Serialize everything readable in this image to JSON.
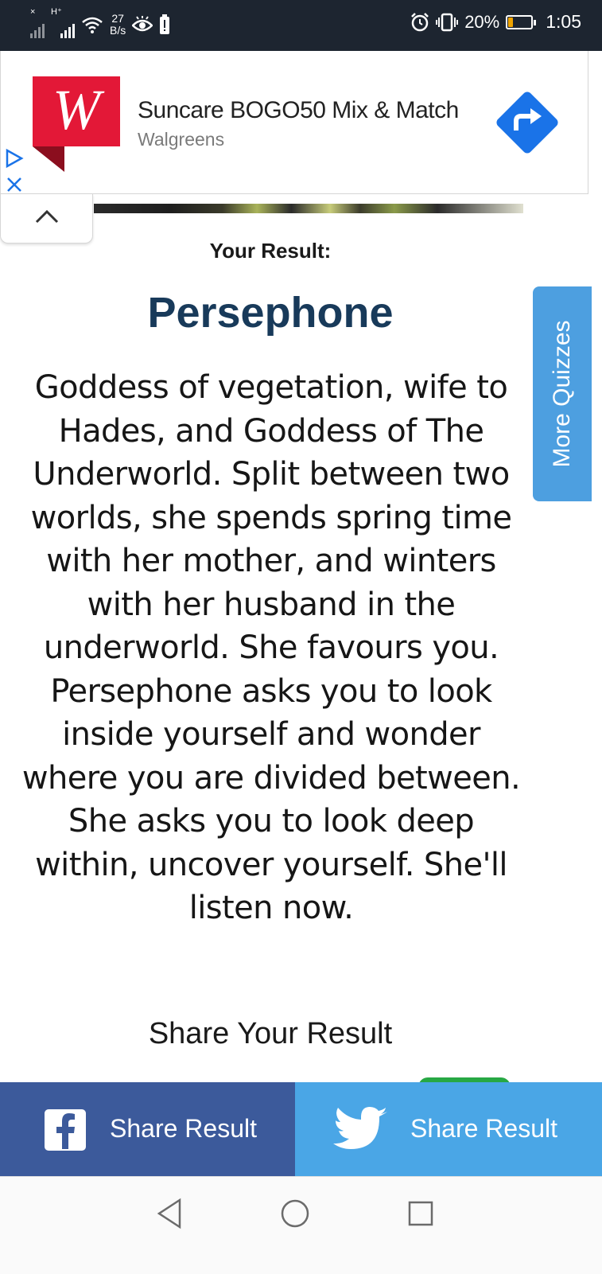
{
  "status_bar": {
    "net_speed_value": "27",
    "net_speed_unit": "B/s",
    "battery_percent": "20%",
    "battery_level": 0.2,
    "time": "1:05",
    "icons": [
      "no-signal-icon",
      "signal-icon",
      "wifi-icon",
      "eye-icon",
      "battery-alert-icon",
      "alarm-icon",
      "vibrate-icon",
      "battery-icon"
    ]
  },
  "ad": {
    "title": "Suncare BOGO50 Mix & Match",
    "advertiser": "Walgreens",
    "logo_letter": "W",
    "brand_color": "#e31837",
    "cta_color": "#1a73e8"
  },
  "content": {
    "your_result_label": "Your Result:",
    "result_name": "Persephone",
    "description": "Goddess of vegetation, wife to Hades, and Goddess of The Underworld. Split between two worlds, she spends spring time with her mother, and winters with her husband in the underworld. She favours you. Persephone asks you to look inside yourself and wonder where you are divided between. She asks you to look deep within, uncover yourself. She'll listen now.",
    "share_heading": "Share Your Result"
  },
  "side_tab": {
    "label": "More Quizzes"
  },
  "share_bar": {
    "facebook_label": "Share Result",
    "twitter_label": "Share Result",
    "facebook_color": "#3c5a9b",
    "twitter_color": "#4aa6e6"
  },
  "navbar": {
    "buttons": [
      "back-icon",
      "home-icon",
      "recents-icon"
    ]
  }
}
